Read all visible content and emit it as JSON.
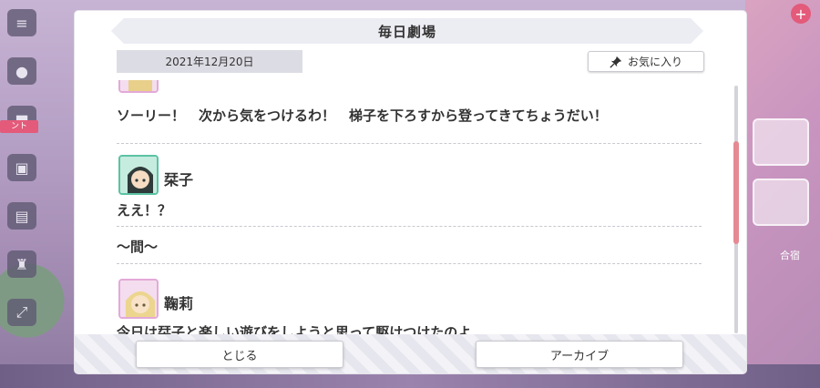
{
  "dialog": {
    "title": "毎日劇場",
    "date": "2021年12月20日",
    "favorite_label": "お気に入り"
  },
  "entries": [
    {
      "speaker": "",
      "text": "ソーリー！　次から気をつけるわ！　梯子を下ろすから登ってきてちょうだい！"
    },
    {
      "speaker": "栞子",
      "text": "ええ！？"
    },
    {
      "speaker": "",
      "text": "〜間〜"
    },
    {
      "speaker": "鞠莉",
      "text": "今日は栞子と楽しい遊びをしようと思って駆けつけたのよ"
    }
  ],
  "footer": {
    "close_label": "とじる",
    "archive_label": "アーカイブ"
  },
  "background": {
    "side_badge": "ント",
    "right_label": "合宿"
  },
  "colors": {
    "scroll_thumb": "#e58a93",
    "title_band": "#ececf3",
    "date_box": "#dcdce4"
  },
  "icons": [
    "pin-icon",
    "menu-icon",
    "chat-icon",
    "gift-icon",
    "trophy-icon",
    "expand-icon",
    "plus-icon"
  ]
}
